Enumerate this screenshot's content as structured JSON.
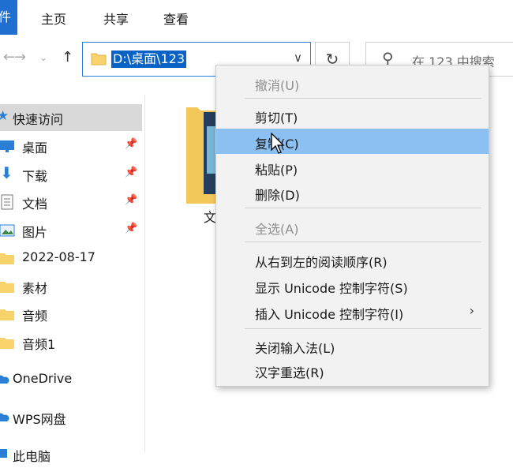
{
  "ribbon": {
    "file_tab": "件",
    "tabs": [
      "主页",
      "共享",
      "查看"
    ]
  },
  "address": {
    "path": "D:\\桌面\\123",
    "search_placeholder": "在 123 中搜索"
  },
  "nav": {
    "items": [
      {
        "label": "快速访问",
        "icon": "star-icon"
      },
      {
        "label": "桌面",
        "icon": "desktop-icon",
        "pinned": true
      },
      {
        "label": "下载",
        "icon": "download-icon",
        "pinned": true
      },
      {
        "label": "文档",
        "icon": "document-icon",
        "pinned": true
      },
      {
        "label": "图片",
        "icon": "picture-icon",
        "pinned": true
      },
      {
        "label": "2022-08-17",
        "icon": "folder-icon"
      },
      {
        "label": "素材",
        "icon": "folder-icon"
      },
      {
        "label": "音频",
        "icon": "folder-icon"
      },
      {
        "label": "音频1",
        "icon": "folder-icon"
      },
      {
        "label": "OneDrive",
        "icon": "cloud-icon"
      },
      {
        "label": "WPS网盘",
        "icon": "cloud-icon"
      },
      {
        "label": "此电脑",
        "icon": "computer-icon"
      }
    ]
  },
  "content": {
    "folder_label": "文"
  },
  "context_menu": {
    "items": [
      {
        "label": "撤消(U)",
        "enabled": false
      },
      {
        "label": "剪切(T)",
        "enabled": true
      },
      {
        "label": "复制(C)",
        "enabled": true,
        "highlighted": true
      },
      {
        "label": "粘贴(P)",
        "enabled": true
      },
      {
        "label": "删除(D)",
        "enabled": true
      },
      {
        "label": "全选(A)",
        "enabled": false
      },
      {
        "label": "从右到左的阅读顺序(R)",
        "enabled": true
      },
      {
        "label": "显示 Unicode 控制字符(S)",
        "enabled": true
      },
      {
        "label": "插入 Unicode 控制字符(I)",
        "enabled": true,
        "submenu": true
      },
      {
        "label": "关闭输入法(L)",
        "enabled": true
      },
      {
        "label": "汉字重选(R)",
        "enabled": true
      }
    ]
  },
  "colors": {
    "accent": "#1e6fd0",
    "selection": "#0a62c4",
    "menu_highlight": "#8cc0f2",
    "folder": "#f8d26a"
  }
}
